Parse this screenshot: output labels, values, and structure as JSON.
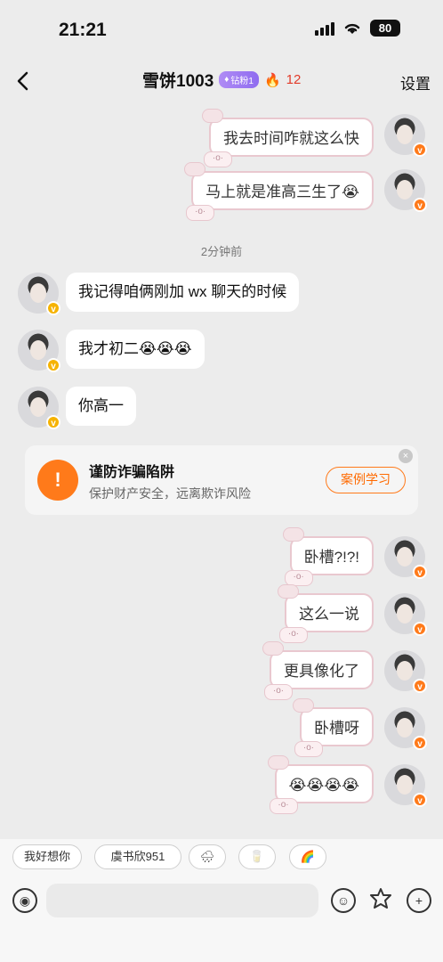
{
  "status_bar": {
    "time": "21:21",
    "battery": "80"
  },
  "header": {
    "title": "雪饼1003",
    "badge": "钻粉1",
    "streak_count": "12",
    "settings_label": "设置"
  },
  "messages_top": [
    {
      "text": "我去时间咋就这么快"
    },
    {
      "text": "马上就是准高三生了😭"
    }
  ],
  "time_divider": "2分钟前",
  "messages_in": [
    {
      "text": "我记得咱俩刚加 wx 聊天的时候"
    },
    {
      "text": "我才初二😭😭😭"
    },
    {
      "text": "你高一"
    }
  ],
  "security_card": {
    "title": "谨防诈骗陷阱",
    "subtitle": "保护财产安全，远离欺诈风险",
    "button_label": "案例学习",
    "close": "×"
  },
  "messages_bottom": [
    {
      "text": "卧槽?!?!"
    },
    {
      "text": "这么一说"
    },
    {
      "text": "更具像化了"
    },
    {
      "text": "卧槽呀"
    },
    {
      "text": "😭😭😭😭"
    }
  ],
  "quick_chips": [
    "我好想你",
    "虞书欣951",
    "🌧",
    "🥛",
    "🌈"
  ],
  "input_bar": {
    "voice_icon": "voice-icon",
    "emoji_icon": "emoji-icon",
    "sticker_icon": "sticker-icon",
    "plus_icon": "plus-icon",
    "placeholder": ""
  },
  "colors": {
    "background": "#ececec",
    "accent": "#ff7a1a",
    "badge_purple": "#8f6cf0",
    "streak_red": "#e23b2a"
  }
}
